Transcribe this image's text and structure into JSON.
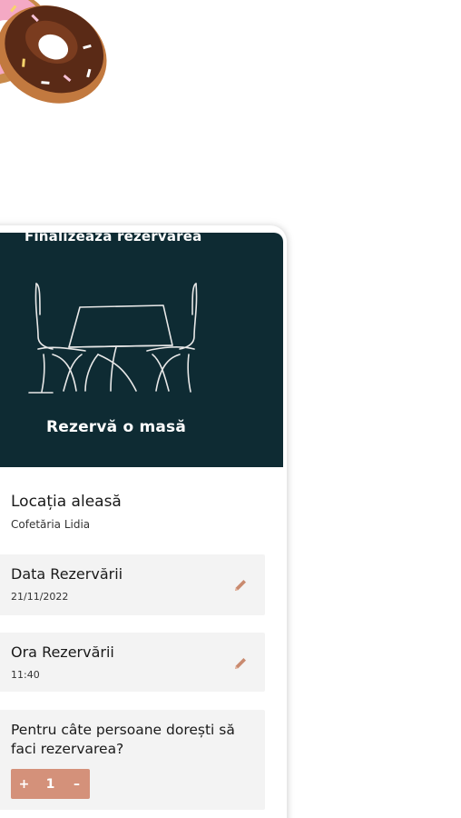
{
  "hero": {
    "top_text": "Finalizeaza rezervarea",
    "title": "Rezervă o masă"
  },
  "location": {
    "title": "Locația aleasă",
    "value": "Cofetăria Lidia"
  },
  "date": {
    "title": "Data Rezervării",
    "value": "21/11/2022",
    "icon": "pencil-icon"
  },
  "time": {
    "title": "Ora Rezervării",
    "value": "11:40",
    "icon": "pencil-icon"
  },
  "people": {
    "question": "Pentru câte persoane dorești să faci rezervarea?",
    "plus_label": "+",
    "count": "1",
    "minus_label": "–"
  },
  "colors": {
    "hero_bg": "#0e2b33",
    "accent": "#d4917a",
    "card_bg": "#f3f3f3"
  }
}
